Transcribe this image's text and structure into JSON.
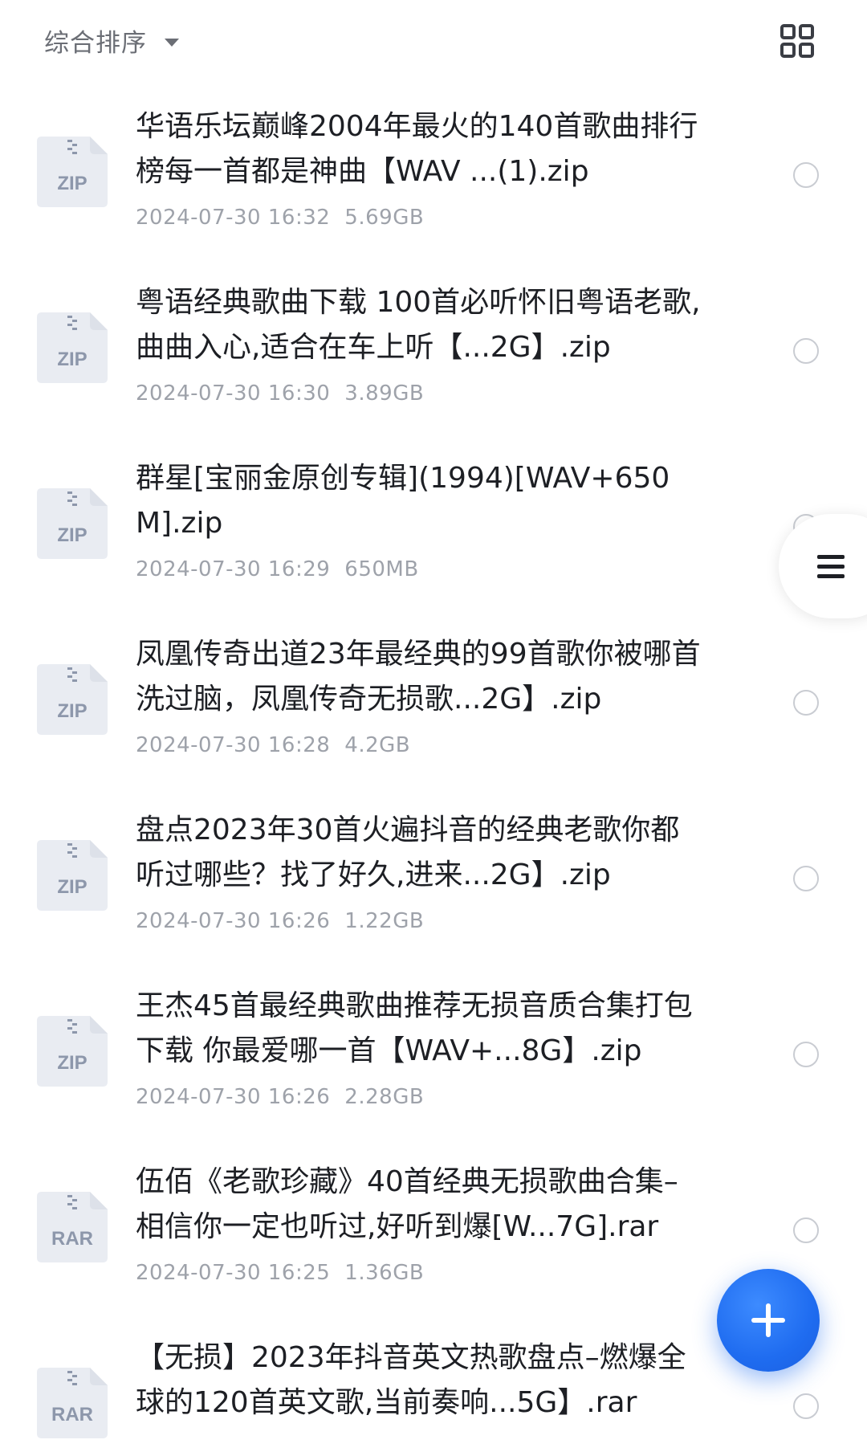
{
  "toolbar": {
    "sort_label": "综合排序",
    "sort_caret_icon": "caret-down-icon",
    "view_toggle_icon": "grid-view-icon"
  },
  "files": [
    {
      "type_label": "ZIP",
      "name": "华语乐坛巅峰2004年最火的140首歌曲排行榜每一首都是神曲【WAV ...(1).zip",
      "date": "2024-07-30 16:32",
      "size": "5.69GB"
    },
    {
      "type_label": "ZIP",
      "name": "粤语经典歌曲下载 100首必听怀旧粤语老歌,曲曲入心,适合在车上听【...2G】.zip",
      "date": "2024-07-30 16:30",
      "size": "3.89GB"
    },
    {
      "type_label": "ZIP",
      "name": "群星[宝丽金原创专辑](1994)[WAV+650M].zip",
      "date": "2024-07-30 16:29",
      "size": "650MB"
    },
    {
      "type_label": "ZIP",
      "name": "凤凰传奇出道23年最经典的99首歌你被哪首洗过脑，凤凰传奇无损歌...2G】.zip",
      "date": "2024-07-30 16:28",
      "size": "4.2GB"
    },
    {
      "type_label": "ZIP",
      "name": "盘点2023年30首火遍抖音的经典老歌你都听过哪些？找了好久,进来...2G】.zip",
      "date": "2024-07-30 16:26",
      "size": "1.22GB"
    },
    {
      "type_label": "ZIP",
      "name": "王杰45首最经典歌曲推荐无损音质合集打包下载 你最爱哪一首【WAV+...8G】.zip",
      "date": "2024-07-30 16:26",
      "size": "2.28GB"
    },
    {
      "type_label": "RAR",
      "name": "伍佰《老歌珍藏》40首经典无损歌曲合集–相信你一定也听过,好听到爆[W...7G].rar",
      "date": "2024-07-30 16:25",
      "size": "1.36GB"
    },
    {
      "type_label": "RAR",
      "name": "【无损】2023年抖音英文热歌盘点–燃爆全球的120首英文歌,当前奏响...5G】.rar",
      "date": "",
      "size": ""
    }
  ],
  "side_handle_icon": "menu-lines-icon",
  "fab_icon": "plus-icon",
  "colors": {
    "accent": "#1f6cf0",
    "title_text": "#1d1f24",
    "meta_text": "#9ea2aa",
    "zip_icon_bg": "#e9ecf2",
    "zip_icon_label": "#8d97ab"
  }
}
